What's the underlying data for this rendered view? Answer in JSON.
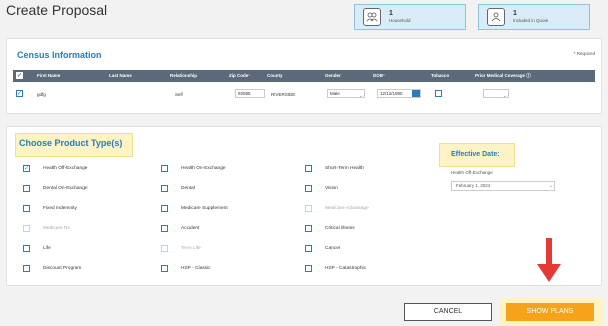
{
  "page": {
    "title": "Create Proposal"
  },
  "stats": [
    {
      "value": "1",
      "label": "Household",
      "icon": "household-icon"
    },
    {
      "value": "1",
      "label": "Included in Quote",
      "icon": "person-icon"
    }
  ],
  "census": {
    "title": "Census Information",
    "required_note": "* Required",
    "headers": {
      "first_name": "First Name",
      "last_name": "Last Name",
      "relationship": "Relationship",
      "zip_code": "Zip Code",
      "county": "County",
      "gender": "Gender",
      "dob": "DOB",
      "tobacco": "Tobacco",
      "prior_coverage": "Prior Medical Coverage"
    },
    "row": {
      "first_name": "gdfg",
      "relationship": "Self",
      "zip_code": "92595",
      "county": "RIVERSIDE",
      "gender": "Male",
      "dob": "12/12/1980"
    }
  },
  "products": {
    "title": "Choose Product Type(s)",
    "items": [
      {
        "label": "Health Off-Exchange",
        "checked": true,
        "disabled": false
      },
      {
        "label": "Health On-Exchange",
        "checked": false,
        "disabled": false
      },
      {
        "label": "Short-Term Health",
        "checked": false,
        "disabled": false
      },
      {
        "label": "Dental On-Exchange",
        "checked": false,
        "disabled": false
      },
      {
        "label": "Dental",
        "checked": false,
        "disabled": false
      },
      {
        "label": "Vision",
        "checked": false,
        "disabled": false
      },
      {
        "label": "Fixed Indemnity",
        "checked": false,
        "disabled": false
      },
      {
        "label": "Medicare Supplement",
        "checked": false,
        "disabled": false
      },
      {
        "label": "Medicare Advantage",
        "checked": false,
        "disabled": true
      },
      {
        "label": "Medicare Rx",
        "checked": false,
        "disabled": true
      },
      {
        "label": "Accident",
        "checked": false,
        "disabled": false
      },
      {
        "label": "Critical Illness",
        "checked": false,
        "disabled": false
      },
      {
        "label": "Life",
        "checked": false,
        "disabled": false
      },
      {
        "label": "Term Life",
        "checked": false,
        "disabled": true
      },
      {
        "label": "Cancer",
        "checked": false,
        "disabled": false
      },
      {
        "label": "Discount Program",
        "checked": false,
        "disabled": false
      },
      {
        "label": "HSP - Classic",
        "checked": false,
        "disabled": false
      },
      {
        "label": "HSP - Catastrophic",
        "checked": false,
        "disabled": false
      }
    ]
  },
  "effective": {
    "title": "Effective Date:",
    "label": "Health Off-Exchange",
    "value": "February 1, 2024"
  },
  "actions": {
    "cancel": "CANCEL",
    "show_plans": "SHOW PLANS"
  },
  "colors": {
    "accent": "#2b7bb9",
    "primary_button": "#f7a21b",
    "highlight": "#fdf3c5",
    "arrow": "#e53935",
    "table_header": "#5a6a7a"
  }
}
